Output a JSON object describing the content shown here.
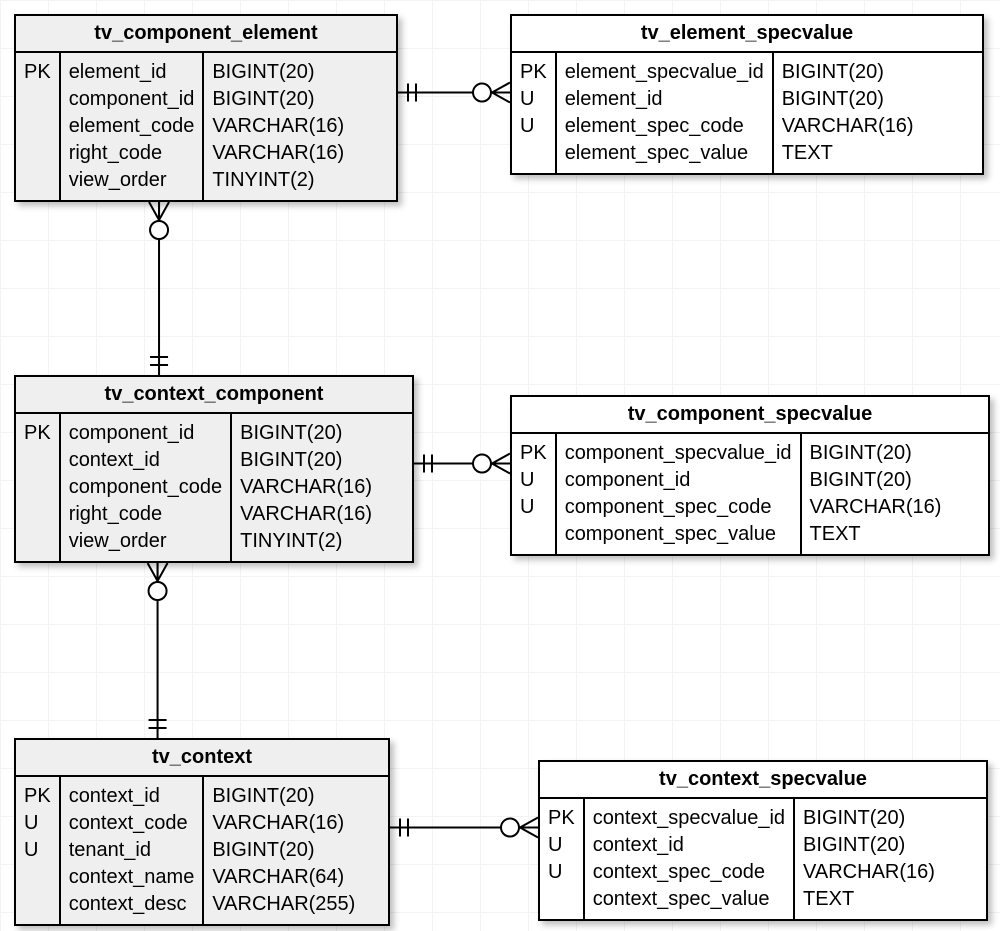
{
  "entities": {
    "e1": {
      "title": "tv_component_element",
      "keys": [
        "PK",
        "",
        "",
        "",
        ""
      ],
      "fields": [
        "element_id",
        "component_id",
        "element_code",
        "right_code",
        "view_order"
      ],
      "types": [
        "BIGINT(20)",
        "BIGINT(20)",
        "VARCHAR(16)",
        "VARCHAR(16)",
        "TINYINT(2)"
      ]
    },
    "e2": {
      "title": "tv_element_specvalue",
      "keys": [
        "PK",
        "U",
        "U",
        ""
      ],
      "fields": [
        "element_specvalue_id",
        "element_id",
        "element_spec_code",
        "element_spec_value"
      ],
      "types": [
        "BIGINT(20)",
        "BIGINT(20)",
        "VARCHAR(16)",
        "TEXT"
      ]
    },
    "e3": {
      "title": "tv_context_component",
      "keys": [
        "PK",
        "",
        "",
        "",
        ""
      ],
      "fields": [
        "component_id",
        "context_id",
        "component_code",
        "right_code",
        "view_order"
      ],
      "types": [
        "BIGINT(20)",
        "BIGINT(20)",
        "VARCHAR(16)",
        "VARCHAR(16)",
        "TINYINT(2)"
      ]
    },
    "e4": {
      "title": "tv_component_specvalue",
      "keys": [
        "PK",
        "U",
        "U",
        ""
      ],
      "fields": [
        "component_specvalue_id",
        "component_id",
        "component_spec_code",
        "component_spec_value"
      ],
      "types": [
        "BIGINT(20)",
        "BIGINT(20)",
        "VARCHAR(16)",
        "TEXT"
      ]
    },
    "e5": {
      "title": "tv_context",
      "keys": [
        "PK",
        "U",
        "U",
        "",
        ""
      ],
      "fields": [
        "context_id",
        "context_code",
        "tenant_id",
        "context_name",
        "context_desc"
      ],
      "types": [
        "BIGINT(20)",
        "VARCHAR(16)",
        "BIGINT(20)",
        "VARCHAR(64)",
        "VARCHAR(255)"
      ]
    },
    "e6": {
      "title": "tv_context_specvalue",
      "keys": [
        "PK",
        "U",
        "U",
        ""
      ],
      "fields": [
        "context_specvalue_id",
        "context_id",
        "context_spec_code",
        "context_spec_value"
      ],
      "types": [
        "BIGINT(20)",
        "BIGINT(20)",
        "VARCHAR(16)",
        "TEXT"
      ]
    }
  },
  "connectors": [
    {
      "from": "e1-right",
      "to": "e2-left",
      "dir": "h"
    },
    {
      "from": "e3-right",
      "to": "e4-left",
      "dir": "h"
    },
    {
      "from": "e5-right",
      "to": "e6-left",
      "dir": "h"
    },
    {
      "from": "e3-top",
      "to": "e1-bottom",
      "dir": "v"
    },
    {
      "from": "e5-top",
      "to": "e3-bottom",
      "dir": "v"
    }
  ]
}
